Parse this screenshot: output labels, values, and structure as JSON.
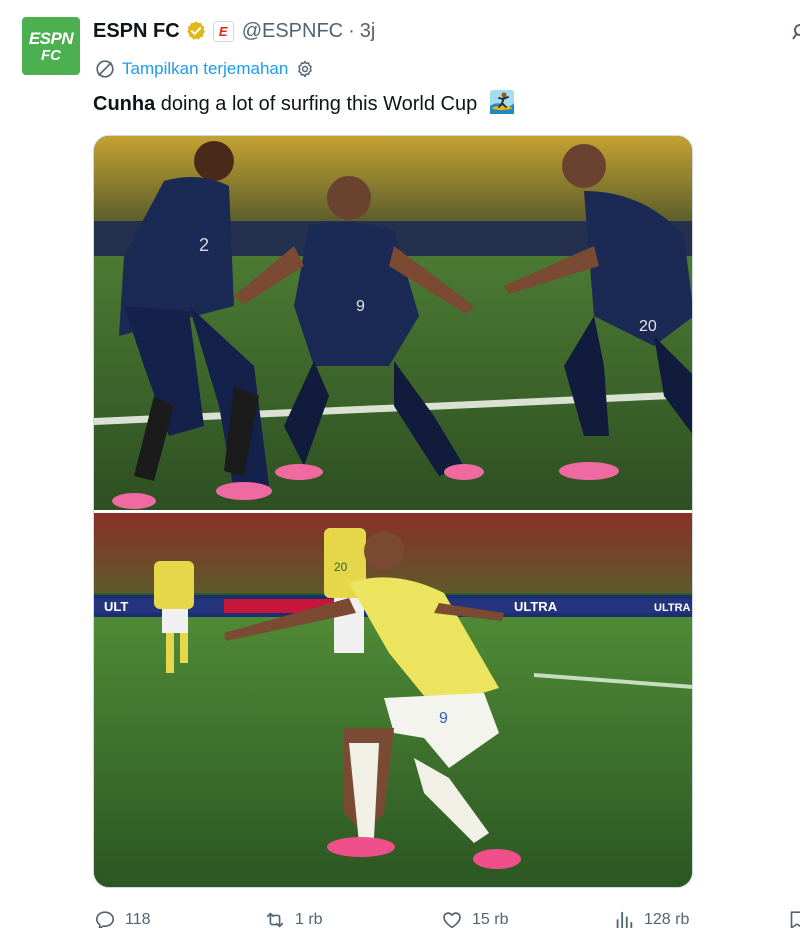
{
  "account": {
    "display_name": "ESPN FC",
    "handle": "@ESPNFC",
    "separator": "·",
    "time": "3j",
    "avatar_line1": "ESPN",
    "avatar_line2": "FC",
    "affiliate_badge": "E",
    "verified_color": "#e2b719",
    "avatar_color": "#4caf50"
  },
  "translate": {
    "label": "Tampilkan terjemahan",
    "color": "#1d9bf0"
  },
  "tweet": {
    "bold": "Cunha",
    "text": " doing a lot of surfing this World Cup"
  },
  "media": {
    "ad_board_text_1": "ULT",
    "ad_board_text_2": "ULTRA",
    "ad_board_text_3": "ULTRA",
    "shirt_number_left": "2",
    "shirt_number_center": "9",
    "shirt_number_right": "20",
    "shirt_number_bg": "20",
    "shirt_number_main": "9"
  },
  "actions": {
    "replies": "118",
    "reposts": "1 rb",
    "likes": "15 rb",
    "views": "128 rb"
  },
  "icons": {
    "verified": "verified-badge-icon",
    "translate": "translate-globe-icon",
    "settings": "gear-icon",
    "reply": "reply-icon",
    "repost": "repost-icon",
    "like": "heart-icon",
    "views": "views-chart-icon",
    "bookmark": "bookmark-icon",
    "more": "more-icon"
  }
}
